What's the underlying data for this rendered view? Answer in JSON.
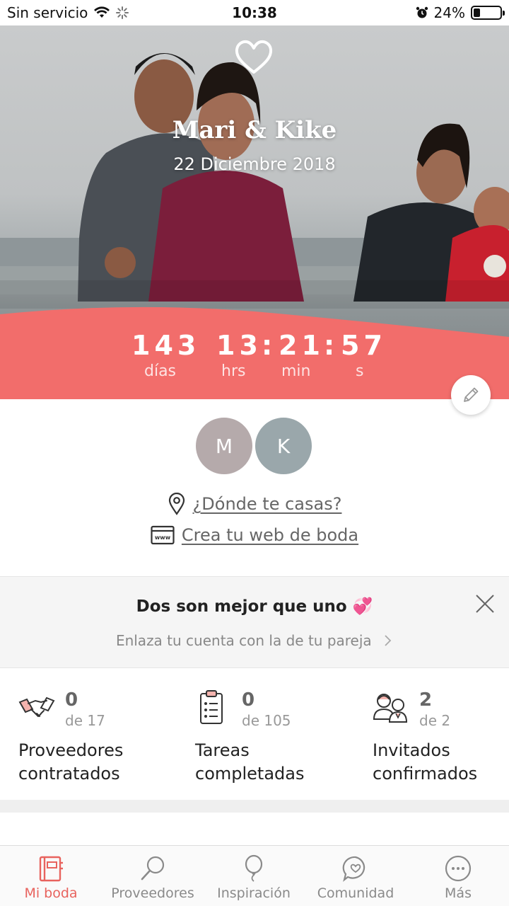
{
  "status_bar": {
    "carrier": "Sin servicio",
    "time": "10:38",
    "battery": "24%",
    "battery_level": 0.24
  },
  "hero": {
    "couple_names": "Mari & Kike",
    "wedding_date": "22 Diciembre 2018",
    "accent_color": "#f26d6b"
  },
  "countdown": {
    "days": "143",
    "hours": "13",
    "minutes": "21",
    "seconds": "57",
    "separator": ":",
    "days_label": "días",
    "hours_label": "hrs",
    "minutes_label": "min",
    "seconds_label": "s"
  },
  "avatars": {
    "partner1_initial": "M",
    "partner2_initial": "K"
  },
  "links": {
    "where_label": "¿Dónde te casas?",
    "web_label": "Crea tu web de boda"
  },
  "promo": {
    "title": "Dos son mejor que uno 💞",
    "subtitle": "Enlaza tu cuenta con la de tu pareja"
  },
  "stats": [
    {
      "count": "0",
      "total": "de 17",
      "label": "Proveedores contratados",
      "icon": "handshake-icon"
    },
    {
      "count": "0",
      "total": "de 105",
      "label": "Tareas completadas",
      "icon": "checklist-icon"
    },
    {
      "count": "2",
      "total": "de 2",
      "label": "Invitados confirmados",
      "icon": "guests-icon"
    }
  ],
  "tabbar": {
    "active_color": "#e8635e",
    "items": [
      {
        "label": "Mi boda",
        "icon": "notebook-icon",
        "active": true
      },
      {
        "label": "Proveedores",
        "icon": "search-icon",
        "active": false
      },
      {
        "label": "Inspiración",
        "icon": "balloon-icon",
        "active": false
      },
      {
        "label": "Comunidad",
        "icon": "chat-heart-icon",
        "active": false
      },
      {
        "label": "Más",
        "icon": "more-icon",
        "active": false
      }
    ]
  }
}
